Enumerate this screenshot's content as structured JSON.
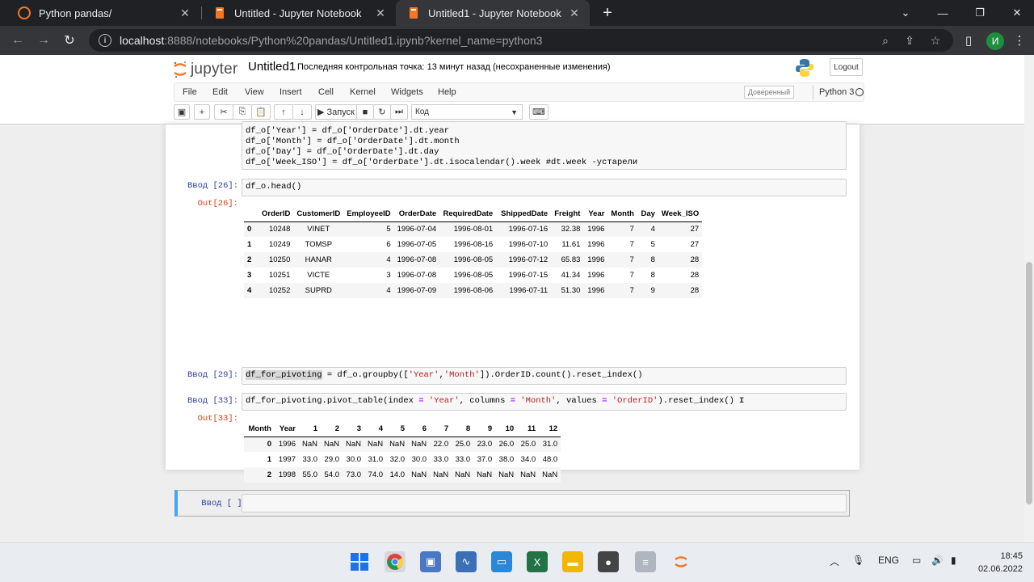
{
  "browser": {
    "tabs": [
      {
        "title": "Python pandas/",
        "active": false
      },
      {
        "title": "Untitled - Jupyter Notebook",
        "active": false
      },
      {
        "title": "Untitled1 - Jupyter Notebook",
        "active": true
      }
    ],
    "new_tab": "+",
    "url_host": "localhost",
    "url_path": ":8888/notebooks/Python%20pandas/Untitled1.ipynb?kernel_name=python3",
    "profile_initial": "И"
  },
  "jupyter": {
    "logo_text": "jupyter",
    "notebook_name": "Untitled1",
    "checkpoint": "Последняя контрольная точка: 13 минут назад  (несохраненные изменения)",
    "logout": "Logout",
    "menu": [
      "File",
      "Edit",
      "View",
      "Insert",
      "Cell",
      "Kernel",
      "Widgets",
      "Help"
    ],
    "trusted": "Доверенный",
    "kernel": "Python 3",
    "toolbar": {
      "run_label": "Запуск",
      "cell_type": "Код"
    }
  },
  "cells": {
    "cell_top": {
      "lines": [
        "df_o['Year'] = df_o['OrderDate'].dt.year",
        "df_o['Month'] = df_o['OrderDate'].dt.month",
        "df_o['Day'] = df_o['OrderDate'].dt.day",
        "df_o['Week_ISO'] = df_o['OrderDate'].dt.isocalendar().week #dt.week -устарели"
      ]
    },
    "cell_26": {
      "in_prompt": "Ввод [26]:",
      "code": "df_o.head()",
      "out_prompt": "Out[26]:",
      "table": {
        "columns": [
          "",
          "OrderID",
          "CustomerID",
          "EmployeeID",
          "OrderDate",
          "RequiredDate",
          "ShippedDate",
          "Freight",
          "Year",
          "Month",
          "Day",
          "Week_ISO"
        ],
        "rows": [
          [
            "0",
            "10248",
            "VINET",
            "5",
            "1996-07-04",
            "1996-08-01",
            "1996-07-16",
            "32.38",
            "1996",
            "7",
            "4",
            "27"
          ],
          [
            "1",
            "10249",
            "TOMSP",
            "6",
            "1996-07-05",
            "1996-08-16",
            "1996-07-10",
            "11.61",
            "1996",
            "7",
            "5",
            "27"
          ],
          [
            "2",
            "10250",
            "HANAR",
            "4",
            "1996-07-08",
            "1996-08-05",
            "1996-07-12",
            "65.83",
            "1996",
            "7",
            "8",
            "28"
          ],
          [
            "3",
            "10251",
            "VICTE",
            "3",
            "1996-07-08",
            "1996-08-05",
            "1996-07-15",
            "41.34",
            "1996",
            "7",
            "8",
            "28"
          ],
          [
            "4",
            "10252",
            "SUPRD",
            "4",
            "1996-07-09",
            "1996-08-06",
            "1996-07-11",
            "51.30",
            "1996",
            "7",
            "9",
            "28"
          ]
        ]
      }
    },
    "cell_29": {
      "in_prompt": "Ввод [29]:",
      "var": "df_for_pivoting",
      "rest_a": " = df_o.groupby([",
      "s1": "'Year'",
      "comma": ",",
      "s2": "'Month'",
      "rest_b": "]).OrderID.count().reset_index()"
    },
    "cell_33": {
      "in_prompt": "Ввод [33]:",
      "a": "df_for_pivoting.pivot_table(index ",
      "eq": "=",
      "s1": " 'Year'",
      "b": ", columns ",
      "s2": " 'Month'",
      "c": ", values ",
      "s3": " 'OrderID'",
      "d": ").reset_index()",
      "out_prompt": "Out[33]:",
      "table": {
        "columns": [
          "Month",
          "Year",
          "1",
          "2",
          "3",
          "4",
          "5",
          "6",
          "7",
          "8",
          "9",
          "10",
          "11",
          "12"
        ],
        "rows": [
          [
            "0",
            "1996",
            "NaN",
            "NaN",
            "NaN",
            "NaN",
            "NaN",
            "NaN",
            "22.0",
            "25.0",
            "23.0",
            "26.0",
            "25.0",
            "31.0"
          ],
          [
            "1",
            "1997",
            "33.0",
            "29.0",
            "30.0",
            "31.0",
            "32.0",
            "30.0",
            "33.0",
            "33.0",
            "37.0",
            "38.0",
            "34.0",
            "48.0"
          ],
          [
            "2",
            "1998",
            "55.0",
            "54.0",
            "73.0",
            "74.0",
            "14.0",
            "NaN",
            "NaN",
            "NaN",
            "NaN",
            "NaN",
            "NaN",
            "NaN"
          ]
        ]
      }
    },
    "cell_empty": {
      "in_prompt": "Ввод [ ]:"
    }
  },
  "taskbar": {
    "lang": "ENG",
    "time": "18:45",
    "date": "02.06.2022"
  }
}
